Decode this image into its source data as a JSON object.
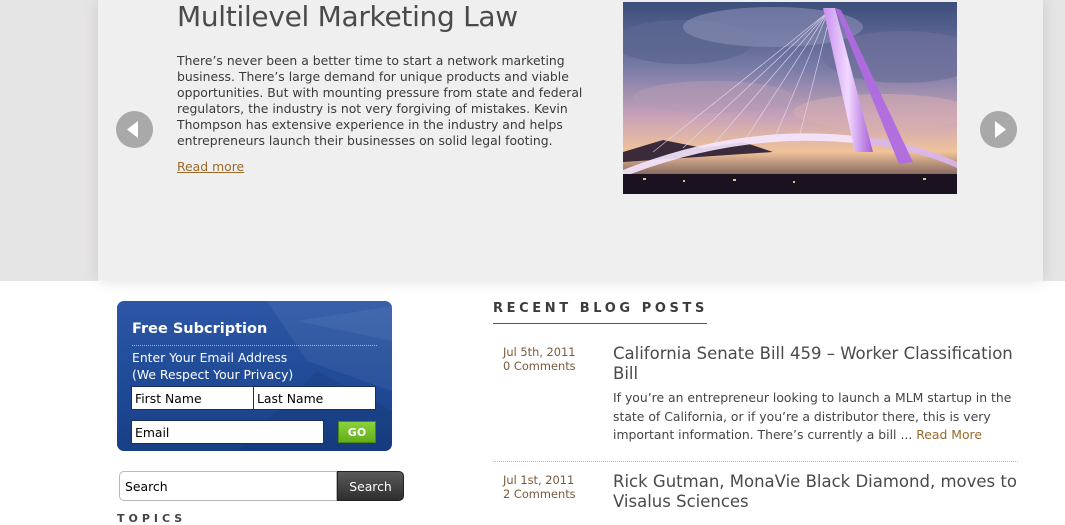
{
  "slider": {
    "title": "Multilevel Marketing Law",
    "text": "There’s never been a better time to start a network marketing business. There’s large demand for unique products and viable opportunities. But with mounting pressure from state and federal regulators, the industry is not very forgiving of mistakes. Kevin Thompson has extensive experience in the industry and helps entrepreneurs launch their businesses on solid legal footing.",
    "read_more": "Read more",
    "prev_icon": "arrow-left-icon",
    "next_icon": "arrow-right-icon"
  },
  "subscription": {
    "title": "Free Subcription",
    "line1": "Enter Your Email Address",
    "line2": "(We Respect Your Privacy)",
    "first_name_placeholder": "First Name",
    "last_name_placeholder": "Last Name",
    "email_placeholder": "Email",
    "go_label": "GO"
  },
  "search": {
    "placeholder": "Search",
    "button_label": "Search"
  },
  "topics": {
    "heading": "TOPICS"
  },
  "recent_posts": {
    "heading": "RECENT BLOG POSTS",
    "posts": [
      {
        "date": "Jul 5th, 2011",
        "comments": "0 Comments",
        "title": "California Senate Bill 459 – Worker Classification Bill",
        "excerpt": "If you’re an entrepreneur looking to launch a MLM startup in the state of California, or if you’re a distributor there, this is very important information.  There’s currently a bill ... ",
        "read_more": "Read More"
      },
      {
        "date": "Jul 1st, 2011",
        "comments": "2 Comments",
        "title": "Rick Gutman, MonaVie Black Diamond, moves to Visalus Sciences"
      }
    ]
  },
  "colors": {
    "link_brown": "#9a6a2a",
    "subscribe_blue": "#2d57a6",
    "go_green": "#63ad1d"
  }
}
